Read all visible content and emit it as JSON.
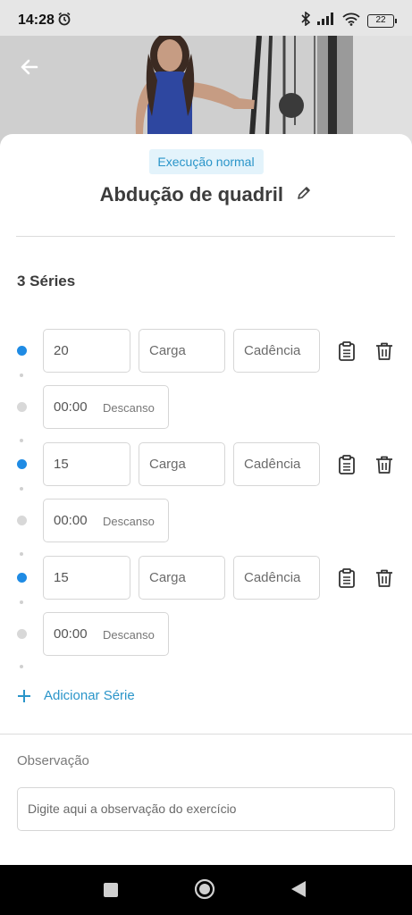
{
  "status_bar": {
    "time": "14:28",
    "battery": "22"
  },
  "header": {
    "back_icon": "arrow-left-icon"
  },
  "exercise": {
    "tag": "Execução normal",
    "title": "Abdução de quadril"
  },
  "series": {
    "heading": "3 Séries",
    "rows": [
      {
        "reps": "20",
        "load_placeholder": "Carga",
        "cadence_placeholder": "Cadência",
        "rest_time": "00:00",
        "rest_label": "Descanso"
      },
      {
        "reps": "15",
        "load_placeholder": "Carga",
        "cadence_placeholder": "Cadência",
        "rest_time": "00:00",
        "rest_label": "Descanso"
      },
      {
        "reps": "15",
        "load_placeholder": "Carga",
        "cadence_placeholder": "Cadência",
        "rest_time": "00:00",
        "rest_label": "Descanso"
      }
    ],
    "add_label": "Adicionar Série"
  },
  "observation": {
    "label": "Observação",
    "placeholder": "Digite aqui a observação do exercício"
  },
  "colors": {
    "accent": "#2a95c9",
    "timeline_active": "#1f8be4",
    "tag_bg": "#e3f3fb"
  }
}
